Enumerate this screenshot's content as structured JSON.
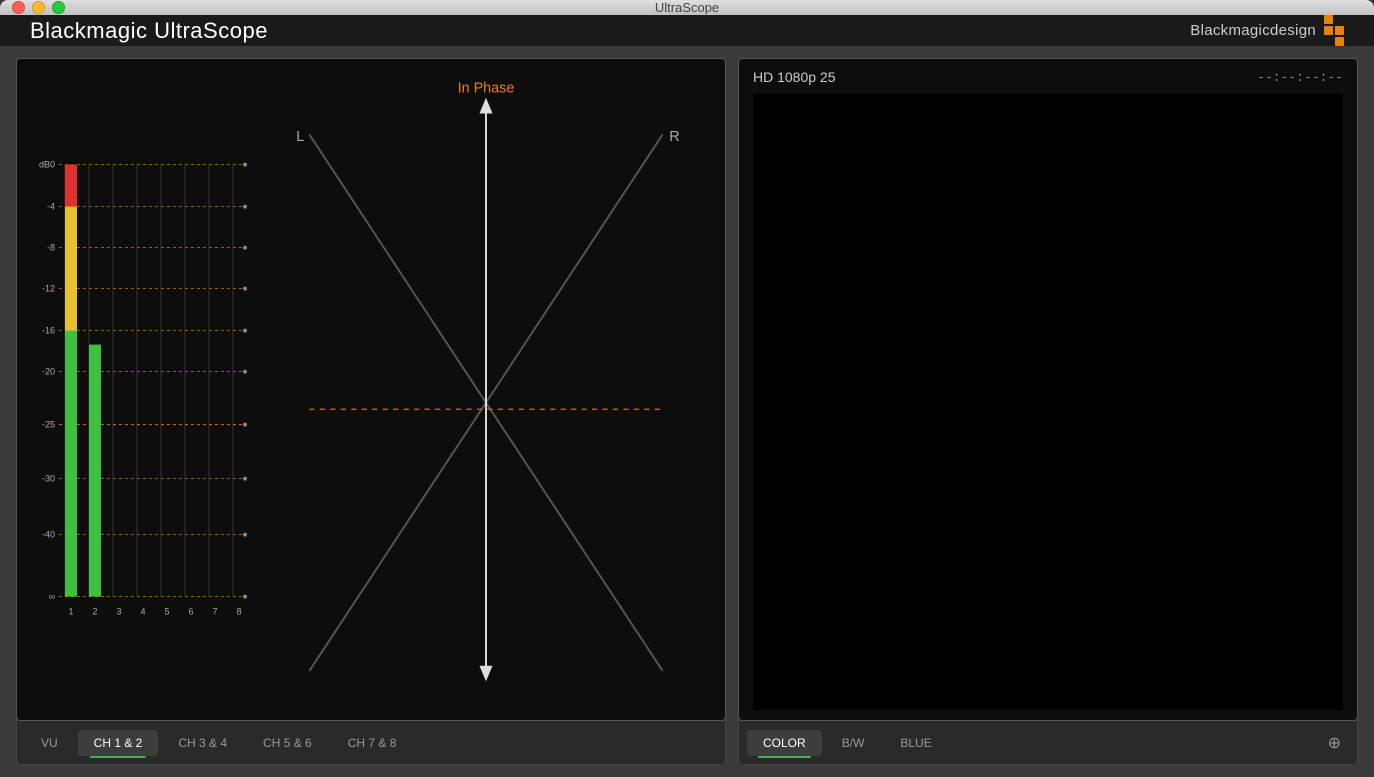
{
  "window": {
    "title": "UltraScope",
    "app_title": "Blackmagic UltraScope",
    "logo_text": "Blackmagicdesign"
  },
  "left_panel": {
    "vu_labels": [
      "dB0",
      "-4",
      "-8",
      "-12",
      "-16",
      "-20",
      "-25",
      "-30",
      "-40",
      "∞"
    ],
    "ch_numbers": [
      "1",
      "2",
      "3",
      "4",
      "5",
      "6",
      "7",
      "8"
    ],
    "phase_label": "In Phase",
    "phase_lr": {
      "l": "L",
      "r": "R"
    },
    "tabs": [
      {
        "id": "vu",
        "label": "VU",
        "active": false
      },
      {
        "id": "ch12",
        "label": "CH 1 & 2",
        "active": true
      },
      {
        "id": "ch34",
        "label": "CH 3 & 4",
        "active": false
      },
      {
        "id": "ch56",
        "label": "CH 5 & 6",
        "active": false
      },
      {
        "id": "ch78",
        "label": "CH 7 & 8",
        "active": false
      }
    ]
  },
  "right_panel": {
    "format": "HD 1080p 25",
    "timecode": "--:--:--:--",
    "tabs": [
      {
        "id": "color",
        "label": "COLOR",
        "active": true
      },
      {
        "id": "bw",
        "label": "B/W",
        "active": false
      },
      {
        "id": "blue",
        "label": "BLUE",
        "active": false
      }
    ],
    "zoom_icon": "⊕"
  },
  "colors": {
    "accent_orange": "#e8820c",
    "active_tab_green": "#4caf50",
    "vu_red": "#e03030",
    "vu_yellow": "#e8c030",
    "vu_green": "#40c040",
    "grid_orange": "#cc7700",
    "grid_dashed": "#cc7700"
  }
}
